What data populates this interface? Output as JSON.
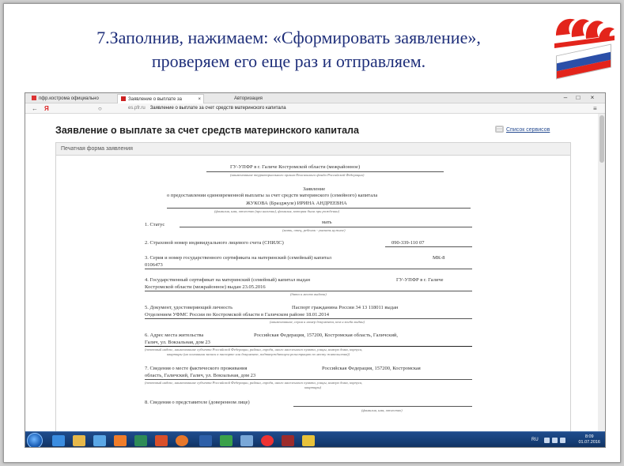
{
  "slide": {
    "title_line1": "7.Заполнив, нажимаем: «Сформировать заявление»,",
    "title_line2": "проверяем его еще раз и отправляем."
  },
  "browser": {
    "tabs": [
      {
        "label": "пфр.кострома официально",
        "active": false
      },
      {
        "label": "Заявление о выплате за",
        "active": true
      },
      {
        "label": "Авторизация",
        "active": false
      }
    ],
    "address_host": "es.pfr.ru",
    "address_title": "Заявление о выплате за счет средств материнского капитала"
  },
  "page": {
    "title": "Заявление о выплате за счет средств материнского капитала",
    "help_link": "Список сервисов",
    "panel_header": "Печатная форма заявления"
  },
  "form": {
    "authority": "ГУ-УПФР в г. Галиче Костромской области (межрайонное)",
    "authority_caption": "(наименование территориального органа Пенсионного фонда Российской Федерации)",
    "doc_title": "Заявление",
    "doc_subtitle": "о предоставлении единовременной выплаты за счет средств материнского (семейного) капитала",
    "applicant": "ЖУКОВА (Бразджуле) ИРИНА АНДРЕЕВНА",
    "applicant_caption": "(фамилия, имя, отчество (при наличии), фамилия, которая была при рождении)",
    "f1_label": "1. Статус",
    "f1_value": "мать",
    "f1_caption": "(мать, отец, ребенок - указать нужное)",
    "f2_label": "2. Страховой номер индивидуального лицевого счета (СНИЛС)",
    "f2_value": "090-339-110 07",
    "f3_label": "3. Серия и номер государственного сертификата на материнский (семейный) капитал",
    "f3_value_a": "МК-8",
    "f3_value_b": "0106473",
    "f4_line1": "4. Государственный сертификат на материнский (семейный) капитал выдан",
    "f4_value": "ГУ-УПФР в г. Галиче",
    "f4_line2": "Костромской области (межрайонное)  выдан 23.05.2016",
    "f4_caption": "(дата и место выдачи)",
    "f5_label": "5. Документ, удостоверяющий личность",
    "f5_value": "Паспорт гражданина России  34 13 118011  выдан",
    "f5_line2": "Отделением УФМС России по Костромской области в Галичском районе  18.01.2014",
    "f5_caption": "(наименование, серия и номер документа, кем и когда выдан)",
    "f6_label": "6. Адрес места жительства",
    "f6_value": "Российская Федерация, 157200, Костромская область, Галичский,",
    "f6_line2": "Галич, ул. Вокзальная, дом 23",
    "f6_caption1": "(почтовый индекс, наименование субъекта Российской Федерации, района, города, иного населенного пункта, улицы, номера дома, корпуса,",
    "f6_caption2": "квартиры (на основании записи в паспорте или документе, подтверждающем регистрацию по месту жительства))",
    "f7_label": "7. Сведения о месте фактического проживания",
    "f7_value": "Российская Федерация, 157200, Костромская",
    "f7_line2": "область, Галичский, Галич, ул. Вокзальная, дом 23",
    "f7_caption1": "(почтовый индекс, наименование субъекта Российской Федерации, района, города, иного населенного пункта, улицы, номера дома, корпуса,",
    "f7_caption2": "квартиры)",
    "f8_label": "8. Сведения о представителе (доверенном лице)",
    "f8_caption": "(фамилия, имя, отчество)"
  },
  "taskbar": {
    "lang": "RU",
    "time": "8:09",
    "date": "01.07.2016"
  },
  "colors": {
    "title_text": "#1f2f7a",
    "taskbar": "#1a447e",
    "logo_red": "#e3241b"
  }
}
